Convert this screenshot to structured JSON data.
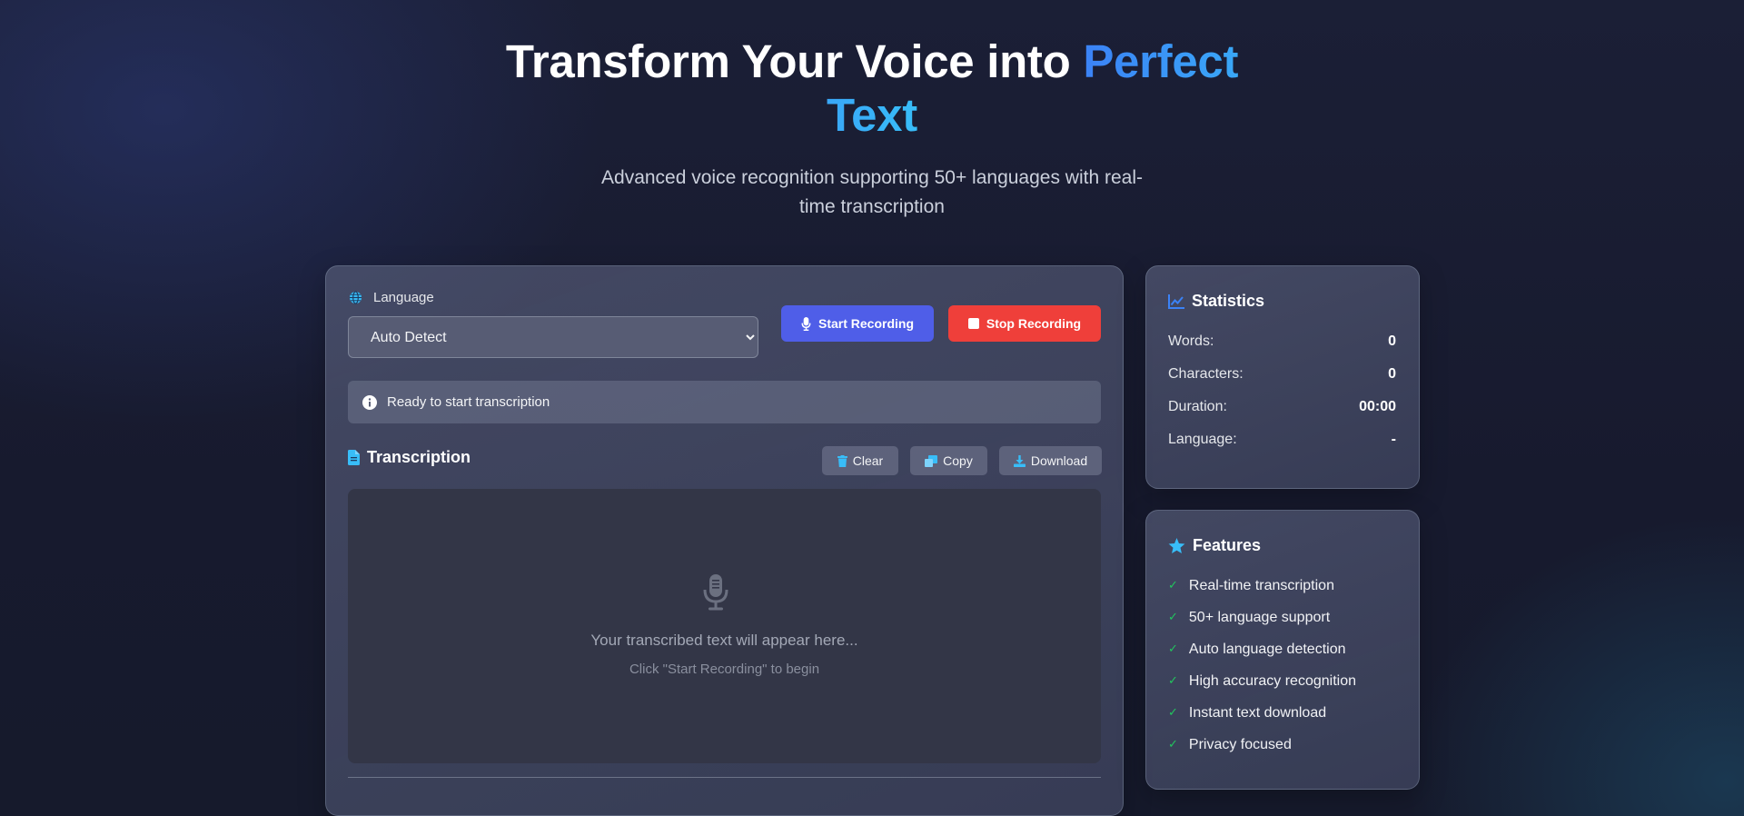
{
  "hero": {
    "title_main": "Transform Your Voice into ",
    "title_accent": "Perfect Text",
    "subtitle": "Advanced voice recognition supporting 50+ languages with real-time transcription"
  },
  "controls": {
    "language_label": "Language",
    "language_selected": "Auto Detect",
    "start_label": "Start Recording",
    "stop_label": "Stop Recording"
  },
  "status": {
    "text": "Ready to start transcription"
  },
  "transcription": {
    "title": "Transcription",
    "clear_label": "Clear",
    "copy_label": "Copy",
    "download_label": "Download",
    "placeholder_main": "Your transcribed text will appear here...",
    "placeholder_sub": "Click \"Start Recording\" to begin"
  },
  "statistics": {
    "title": "Statistics",
    "rows": [
      {
        "label": "Words:",
        "value": "0"
      },
      {
        "label": "Characters:",
        "value": "0"
      },
      {
        "label": "Duration:",
        "value": "00:00"
      },
      {
        "label": "Language:",
        "value": "-"
      }
    ]
  },
  "features": {
    "title": "Features",
    "items": [
      "Real-time transcription",
      "50+ language support",
      "Auto language detection",
      "High accuracy recognition",
      "Instant text download",
      "Privacy focused"
    ]
  },
  "colors": {
    "accent_blue": "#3b82f6",
    "accent_cyan": "#38bdf8",
    "start_button": "#4f5ee8",
    "stop_button": "#ef3f3a",
    "check_green": "#22c55e"
  },
  "icons": {
    "language": "globe-icon",
    "start": "microphone-icon",
    "stop": "stop-square-icon",
    "status": "info-icon",
    "transcription": "document-icon",
    "clear": "trash-icon",
    "copy": "copy-icon",
    "download": "download-icon",
    "placeholder": "microphone-icon",
    "statistics": "chart-line-icon",
    "features": "star-icon",
    "feature_item": "check-icon"
  }
}
